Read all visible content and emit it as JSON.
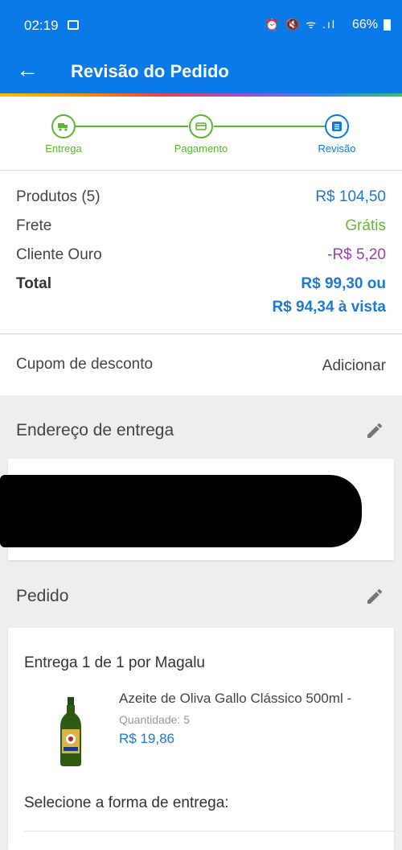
{
  "status_bar": {
    "time": "02:19",
    "indicators": "⏰ 🔇 ᯤ .ıl",
    "battery": "66%"
  },
  "app_bar": {
    "back_icon": "←",
    "title": "Revisão do Pedido"
  },
  "stepper": {
    "steps": [
      {
        "label": "Entrega",
        "icon": "truck-icon"
      },
      {
        "label": "Pagamento",
        "icon": "card-icon"
      },
      {
        "label": "Revisão",
        "icon": "list-icon"
      }
    ],
    "colors": {
      "done": "#5bb630",
      "current": "#0a7ae8"
    }
  },
  "summary": {
    "products_label": "Produtos (5)",
    "products_value": "R$ 104,50",
    "shipping_label": "Frete",
    "shipping_value": "Grátis",
    "gold_label": "Cliente Ouro",
    "gold_value": "-R$ 5,20",
    "total_label": "Total",
    "total_value_line1": "R$ 99,30 ou",
    "total_value_line2": "R$ 94,34 à vista"
  },
  "coupon": {
    "label": "Cupom de desconto",
    "action": "Adicionar"
  },
  "address": {
    "title": "Endereço de entrega"
  },
  "order": {
    "title": "Pedido",
    "shipment_title": "Entrega 1 de 1 por Magalu",
    "product_name": "Azeite de Oliva Gallo Clássico 500ml -",
    "quantity_label": "Quantidade:",
    "quantity_value": "5",
    "price": "R$ 19,86",
    "shipping_method_label": "Selecione a forma de entrega:"
  },
  "colors": {
    "primary": "#0a7ae8",
    "price_blue": "#1a7ad4",
    "green": "#6bb33a",
    "purple": "#9b3eb0"
  }
}
